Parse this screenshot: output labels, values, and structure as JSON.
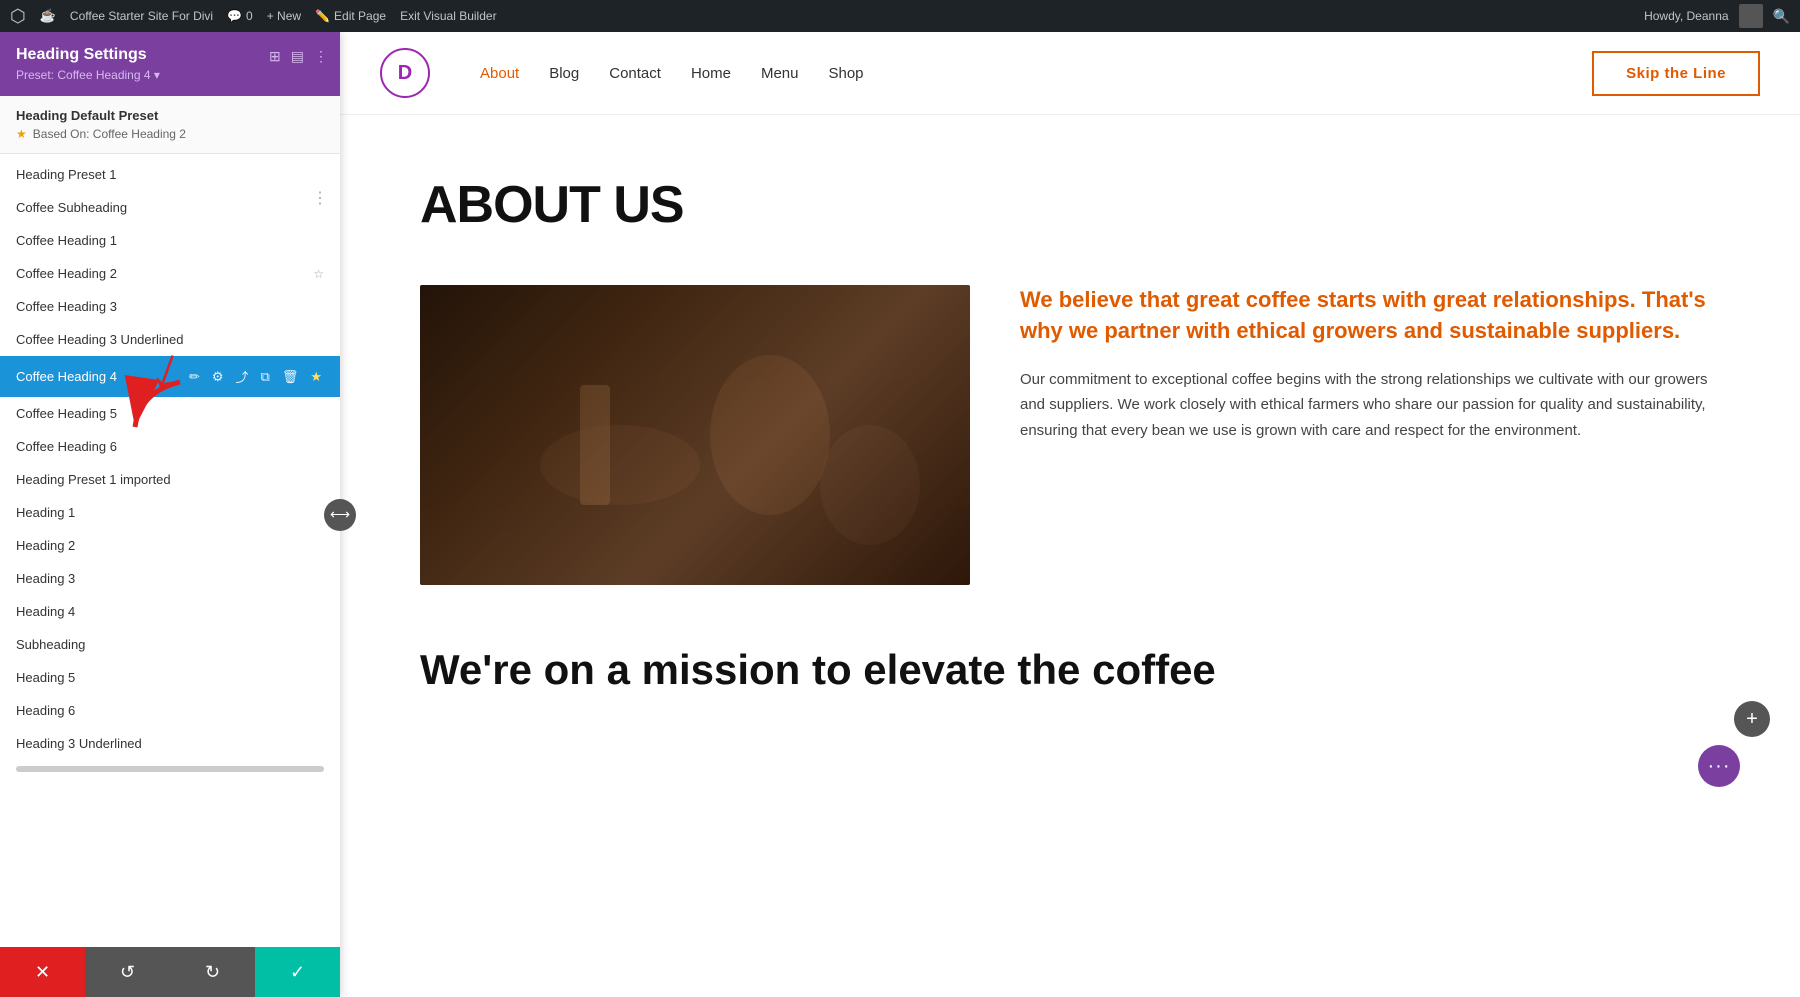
{
  "adminBar": {
    "wpLabel": "W",
    "siteName": "Coffee Starter Site For Divi",
    "commentIcon": "💬",
    "commentCount": "0",
    "newLabel": "+ New",
    "editPageLabel": "Edit Page",
    "exitBuilderLabel": "Exit Visual Builder",
    "howdy": "Howdy, Deanna",
    "searchIcon": "🔍"
  },
  "panel": {
    "title": "Heading Settings",
    "preset": "Preset: Coffee Heading 4 ▾",
    "defaultPreset": {
      "label": "Heading Default Preset",
      "basedOn": "Based On: Coffee Heading 2"
    },
    "presets": [
      {
        "id": "heading-preset-1",
        "label": "Heading Preset 1",
        "starred": false,
        "active": false
      },
      {
        "id": "coffee-subheading",
        "label": "Coffee Subheading",
        "starred": false,
        "active": false
      },
      {
        "id": "coffee-heading-1",
        "label": "Coffee Heading 1",
        "starred": false,
        "active": false
      },
      {
        "id": "coffee-heading-2",
        "label": "Coffee Heading 2",
        "starred": true,
        "active": false
      },
      {
        "id": "coffee-heading-3",
        "label": "Coffee Heading 3",
        "starred": false,
        "active": false
      },
      {
        "id": "coffee-heading-3-underlined",
        "label": "Coffee Heading 3 Underlined",
        "starred": false,
        "active": false
      },
      {
        "id": "coffee-heading-4",
        "label": "Coffee Heading 4",
        "starred": true,
        "active": true
      },
      {
        "id": "coffee-heading-5",
        "label": "Coffee Heading 5",
        "starred": false,
        "active": false
      },
      {
        "id": "coffee-heading-6",
        "label": "Coffee Heading 6",
        "starred": false,
        "active": false
      },
      {
        "id": "heading-preset-1-imported",
        "label": "Heading Preset 1 imported",
        "starred": false,
        "active": false
      },
      {
        "id": "heading-1",
        "label": "Heading 1",
        "starred": false,
        "active": false
      },
      {
        "id": "heading-2",
        "label": "Heading 2",
        "starred": false,
        "active": false
      },
      {
        "id": "heading-3",
        "label": "Heading 3",
        "starred": false,
        "active": false
      },
      {
        "id": "heading-4",
        "label": "Heading 4",
        "starred": false,
        "active": false
      },
      {
        "id": "subheading",
        "label": "Subheading",
        "starred": false,
        "active": false
      },
      {
        "id": "heading-5",
        "label": "Heading 5",
        "starred": false,
        "active": false
      },
      {
        "id": "heading-6",
        "label": "Heading 6",
        "starred": false,
        "active": false
      },
      {
        "id": "heading-3-underlined",
        "label": "Heading 3 Underlined",
        "starred": false,
        "active": false
      }
    ],
    "bottomBar": {
      "cancelIcon": "✕",
      "undoIcon": "↺",
      "redoIcon": "↻",
      "saveIcon": "✓"
    }
  },
  "site": {
    "logoLetter": "D",
    "nav": [
      {
        "id": "about",
        "label": "About",
        "active": true
      },
      {
        "id": "blog",
        "label": "Blog",
        "active": false
      },
      {
        "id": "contact",
        "label": "Contact",
        "active": false
      },
      {
        "id": "home",
        "label": "Home",
        "active": false
      },
      {
        "id": "menu",
        "label": "Menu",
        "active": false
      },
      {
        "id": "shop",
        "label": "Shop",
        "active": false
      }
    ],
    "ctaButton": "Skip the Line"
  },
  "pageContent": {
    "heading": "ABOUT US",
    "sidebarHeadline": "We believe that great coffee starts with great relationships. That's why we partner with ethical growers and sustainable suppliers.",
    "sidebarBody": "Our commitment to exceptional coffee begins with the strong relationships we cultivate with our growers and suppliers. We work closely with ethical farmers who share our passion for quality and sustainability, ensuring that every bean we use is grown with care and respect for the environment.",
    "missionHeading": "We're on a mission to elevate the coffee"
  }
}
